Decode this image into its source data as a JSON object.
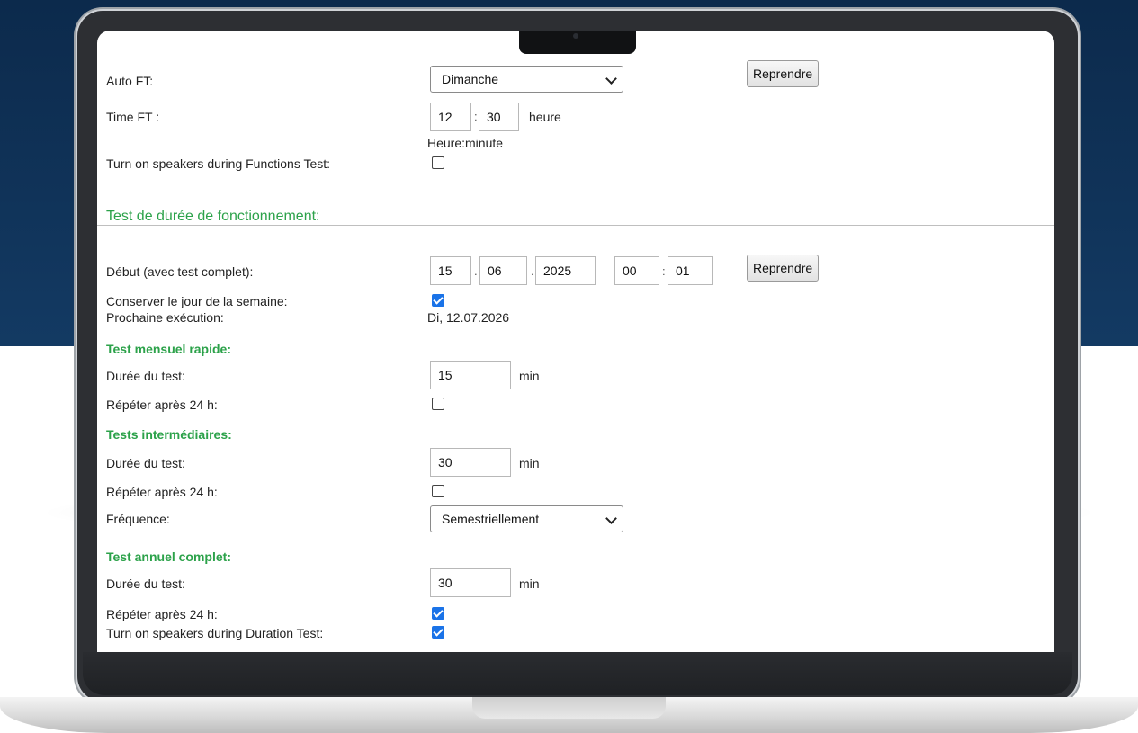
{
  "auto_ft": {
    "label": "Auto FT:",
    "selected": "Dimanche",
    "resume_label": "Reprendre"
  },
  "time_ft": {
    "label": "Time FT    :",
    "hour": "12",
    "sep": ":",
    "minute": "30",
    "unit": "heure",
    "hint": "Heure:minute"
  },
  "speakers_ft": {
    "label": "Turn on speakers during Functions Test:",
    "checked": false
  },
  "duration_section": {
    "title": "Test de durée de fonctionnement:"
  },
  "start": {
    "label": "Début (avec test complet):",
    "day": "15",
    "dot1": ".",
    "month": "06",
    "dot2": ".",
    "year": "2025",
    "hour": "00",
    "colon": ":",
    "minute": "01",
    "resume_label": "Reprendre"
  },
  "keep_weekday": {
    "label": "Conserver le jour de la semaine:",
    "checked": true
  },
  "next_run": {
    "label": "Prochaine exécution:",
    "value": "Di, 12.07.2026"
  },
  "monthly": {
    "title": "Test mensuel rapide:",
    "duration_label": "Durée du test:",
    "duration_value": "15",
    "unit": "min",
    "repeat_label": "Répéter après 24 h:",
    "repeat_checked": false
  },
  "intermediate": {
    "title": "Tests intermédiaires:",
    "duration_label": "Durée du test:",
    "duration_value": "30",
    "unit": "min",
    "repeat_label": "Répéter après 24 h:",
    "repeat_checked": false,
    "frequency_label": "Fréquence:",
    "frequency_selected": "Semestriellement"
  },
  "annual": {
    "title": "Test annuel complet:",
    "duration_label": "Durée du test:",
    "duration_value": "30",
    "unit": "min",
    "repeat_label": "Répéter après 24 h:",
    "repeat_checked": true,
    "speakers_label": "Turn on speakers during Duration Test:",
    "speakers_checked": true
  },
  "colors": {
    "section_green": "#2ca24a",
    "checkbox_blue": "#1a73e8",
    "background_navy": "#0c2a4c"
  },
  "icons": {
    "select_arrow": "chevron-down-icon",
    "checked_box": "checkbox-checked-icon",
    "empty_box": "checkbox-empty-icon"
  }
}
